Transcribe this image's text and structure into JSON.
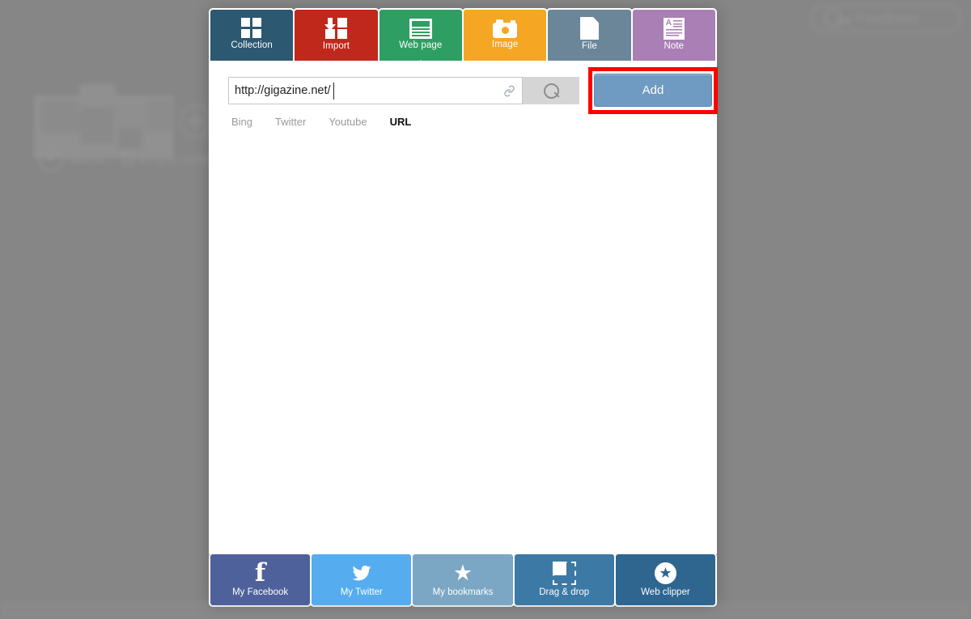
{
  "background": {
    "about_label": "about",
    "collection_label": "empty collection",
    "search_placeholder": "Pearltrees"
  },
  "panel": {
    "tabs": [
      {
        "label": "Collection",
        "icon": "grid-icon",
        "color": "#2d5871",
        "active": false
      },
      {
        "label": "Import",
        "icon": "import-icon",
        "color": "#c0281c",
        "active": false
      },
      {
        "label": "Web page",
        "icon": "webpage-icon",
        "color": "#2f9e63",
        "active": true
      },
      {
        "label": "Image",
        "icon": "camera-icon",
        "color": "#f5a623",
        "active": false
      },
      {
        "label": "File",
        "icon": "document-icon",
        "color": "#6b8699",
        "active": false
      },
      {
        "label": "Note",
        "icon": "note-icon",
        "color": "#a97fb5",
        "active": false
      }
    ],
    "search": {
      "url_value": "http://gigazine.net/",
      "url_placeholder": "",
      "link_icon": "chain-link-icon",
      "search_icon": "magnifier-icon",
      "add_label": "Add",
      "add_button_color": "#6f9ac1",
      "highlight_color": "#ff0000"
    },
    "sources": [
      {
        "label": "Bing",
        "active": false
      },
      {
        "label": "Twitter",
        "active": false
      },
      {
        "label": "Youtube",
        "active": false
      },
      {
        "label": "URL",
        "active": true
      }
    ],
    "bottom_tiles": [
      {
        "label": "My Facebook",
        "icon": "facebook-icon",
        "color": "#4f619b"
      },
      {
        "label": "My Twitter",
        "icon": "twitter-icon",
        "color": "#55acee"
      },
      {
        "label": "My bookmarks",
        "icon": "star-icon",
        "color": "#7ba7c4"
      },
      {
        "label": "Drag & drop",
        "icon": "dragdrop-icon",
        "color": "#3d79a5"
      },
      {
        "label": "Web clipper",
        "icon": "clipper-icon",
        "color": "#2f6690"
      }
    ]
  }
}
